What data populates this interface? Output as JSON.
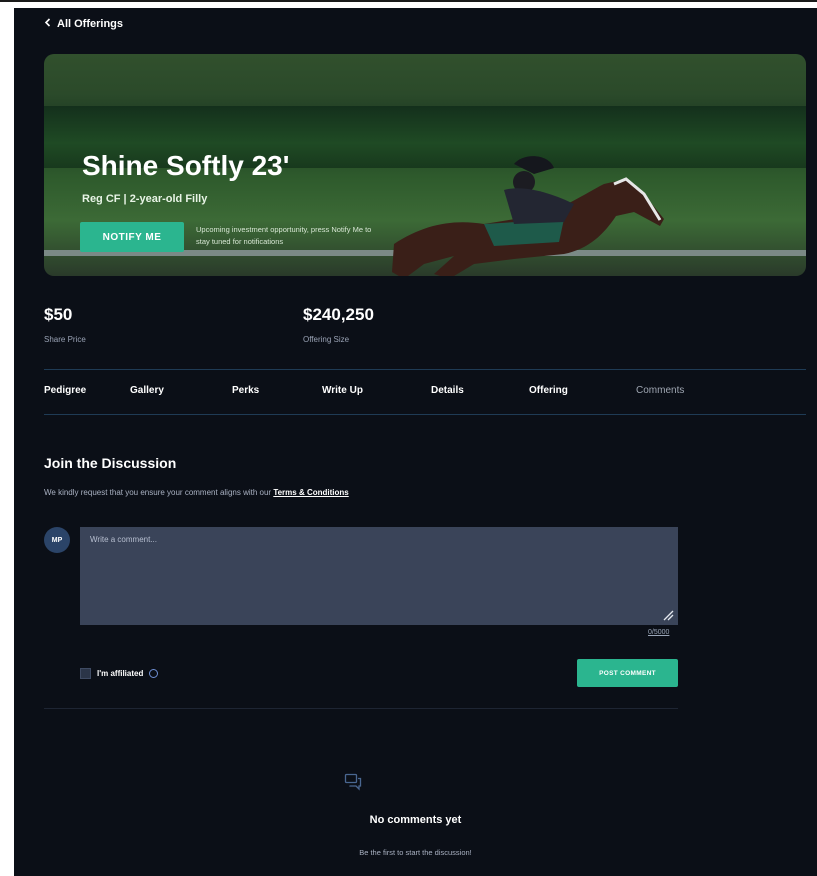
{
  "nav": {
    "back_label": "All Offerings"
  },
  "hero": {
    "title": "Shine Softly 23'",
    "subtitle": "Reg CF | 2-year-old Filly",
    "notify_label": "NOTIFY ME",
    "note": "Upcoming investment opportunity, press Notify Me to stay tuned for notifications"
  },
  "stats": [
    {
      "value": "$50",
      "label": "Share Price"
    },
    {
      "value": "$240,250",
      "label": "Offering Size"
    }
  ],
  "tabs": [
    "Pedigree",
    "Gallery",
    "Perks",
    "Write Up",
    "Details",
    "Offering",
    "Comments"
  ],
  "active_tab": "Comments",
  "discussion": {
    "title": "Join the Discussion",
    "text": "We kindly request that you ensure your comment aligns with our",
    "link": "Terms & Conditions",
    "avatar_initials": "MP",
    "placeholder": "Write a comment...",
    "counter": "0/5000",
    "affiliated_label": "I'm affiliated",
    "post_label": "POST COMMENT"
  },
  "empty": {
    "title": "No comments yet",
    "subtitle": "Be the first to start the discussion!"
  },
  "colors": {
    "accent": "#2bb58f",
    "background": "#0b0f17",
    "input_bg": "#3a4459"
  }
}
